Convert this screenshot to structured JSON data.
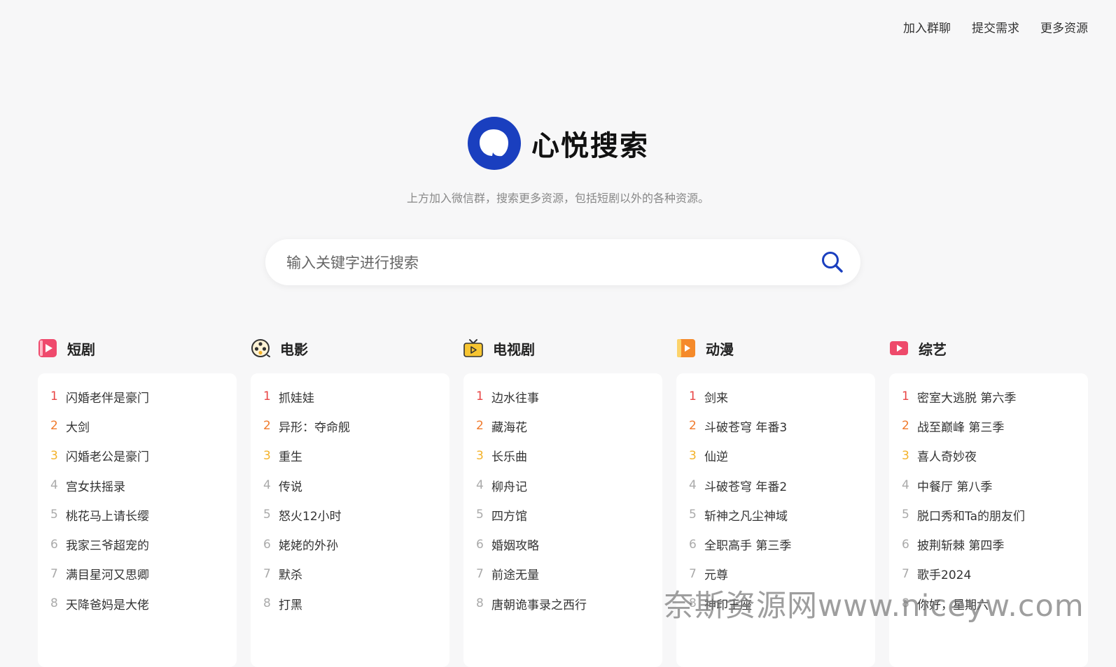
{
  "topnav": [
    {
      "label": "加入群聊"
    },
    {
      "label": "提交需求"
    },
    {
      "label": "更多资源"
    }
  ],
  "brand": {
    "name": "心悦搜索",
    "tagline": "上方加入微信群，搜索更多资源，包括短剧以外的各种资源。",
    "color": "#1a3fbf"
  },
  "search": {
    "placeholder": "输入关键字进行搜索",
    "value": ""
  },
  "categories": [
    {
      "title": "短剧",
      "icon": "play-square-icon",
      "items": [
        "闪婚老伴是豪门",
        "大剑",
        "闪婚老公是豪门",
        "宫女扶摇录",
        "桃花马上请长缨",
        "我家三爷超宠的",
        "满目星河又思卿",
        "天降爸妈是大佬"
      ]
    },
    {
      "title": "电影",
      "icon": "film-reel-icon",
      "items": [
        "抓娃娃",
        "异形：夺命舰",
        "重生",
        "传说",
        "怒火12小时",
        "姥姥的外孙",
        "默杀",
        "打黑"
      ]
    },
    {
      "title": "电视剧",
      "icon": "tv-icon",
      "items": [
        "边水往事",
        "藏海花",
        "长乐曲",
        "柳舟记",
        "四方馆",
        "婚姻攻略",
        "前途无量",
        "唐朝诡事录之西行"
      ]
    },
    {
      "title": "动漫",
      "icon": "animation-icon",
      "items": [
        "剑来",
        "斗破苍穹 年番3",
        "仙逆",
        "斗破苍穹 年番2",
        "斩神之凡尘神域",
        "全职高手 第三季",
        "元尊",
        "神印王座"
      ]
    },
    {
      "title": "综艺",
      "icon": "video-play-icon",
      "items": [
        "密室大逃脱 第六季",
        "战至巅峰 第三季",
        "喜人奇妙夜",
        "中餐厅 第八季",
        "脱口秀和Ta的朋友们",
        "披荆斩棘 第四季",
        "歌手2024",
        "你好，星期六"
      ]
    }
  ],
  "watermark": "奈斯资源网www.niceyw.com"
}
